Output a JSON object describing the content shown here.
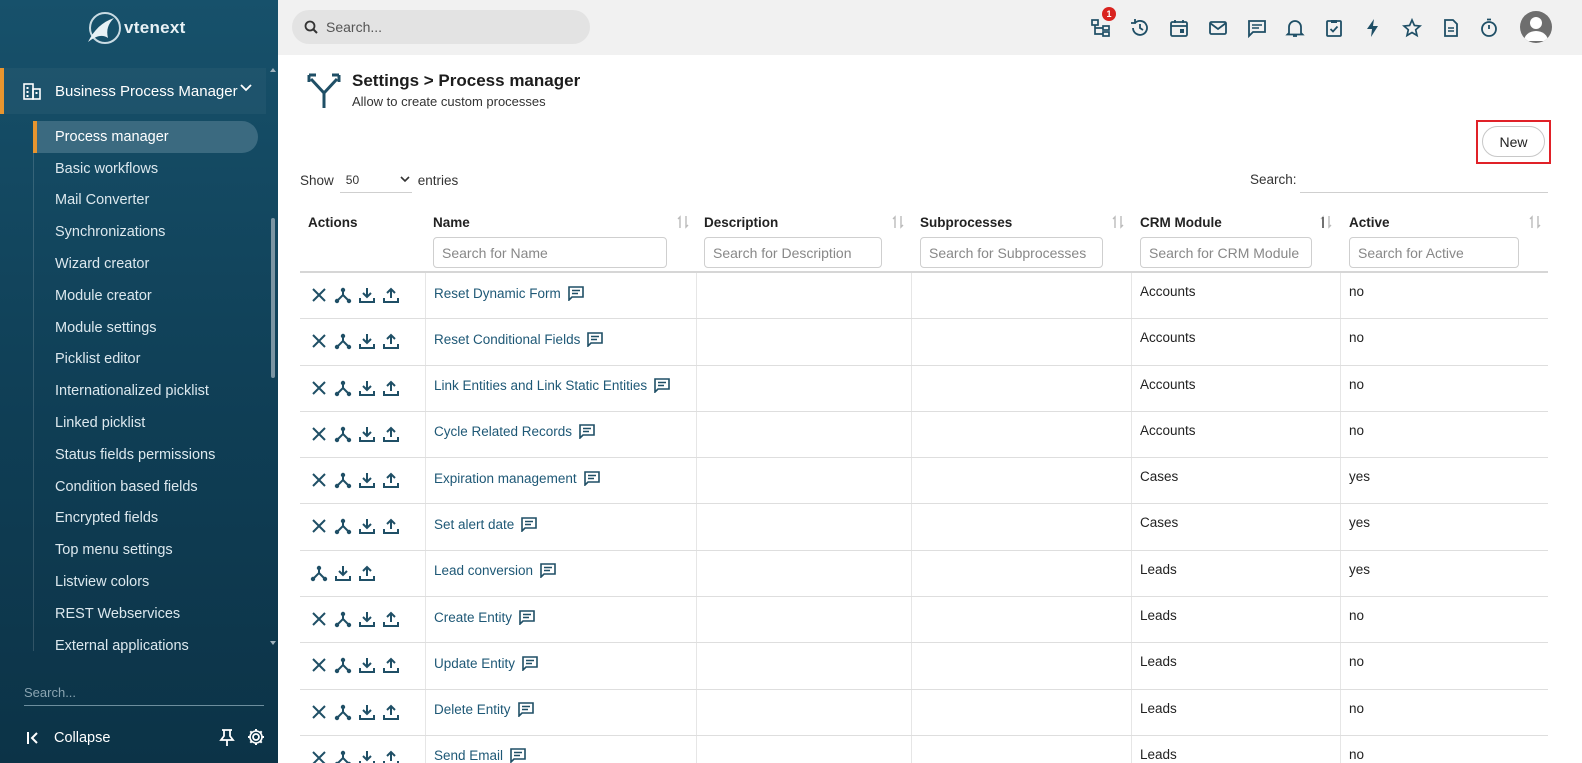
{
  "brand": {
    "logo_text": "vtenext"
  },
  "sidebar": {
    "section_label": "Business Process Manager",
    "items": [
      {
        "label": "Process manager",
        "active": true
      },
      {
        "label": "Basic workflows"
      },
      {
        "label": "Mail Converter"
      },
      {
        "label": "Synchronizations"
      },
      {
        "label": "Wizard creator"
      },
      {
        "label": "Module creator"
      },
      {
        "label": "Module settings"
      },
      {
        "label": "Picklist editor"
      },
      {
        "label": "Internationalized picklist"
      },
      {
        "label": "Linked picklist"
      },
      {
        "label": "Status fields permissions"
      },
      {
        "label": "Condition based fields"
      },
      {
        "label": "Encrypted fields"
      },
      {
        "label": "Top menu settings"
      },
      {
        "label": "Listview colors"
      },
      {
        "label": "REST Webservices"
      },
      {
        "label": "External applications"
      }
    ],
    "search_placeholder": "Search...",
    "collapse_label": "Collapse"
  },
  "topbar": {
    "search_placeholder": "Search...",
    "icons": [
      "process-tree-icon",
      "history-icon",
      "calendar-icon",
      "mail-icon",
      "chat-icon",
      "bell-icon",
      "task-check-icon",
      "lightning-icon",
      "star-icon",
      "document-icon",
      "timer-icon"
    ],
    "notification_badge": "1"
  },
  "page": {
    "title": "Settings > Process manager",
    "subtitle": "Allow to create custom processes",
    "new_button": "New"
  },
  "table_controls": {
    "show_label": "Show",
    "entries_value": "50",
    "entries_label": "entries",
    "search_label": "Search:"
  },
  "table": {
    "columns": [
      {
        "label": "Actions"
      },
      {
        "label": "Name",
        "filter_placeholder": "Search for Name"
      },
      {
        "label": "Description",
        "filter_placeholder": "Search for Description"
      },
      {
        "label": "Subprocesses",
        "filter_placeholder": "Search for Subprocesses"
      },
      {
        "label": "CRM Module",
        "filter_placeholder": "Search for CRM Module"
      },
      {
        "label": "Active",
        "filter_placeholder": "Search for Active"
      }
    ],
    "rows": [
      {
        "name": "Reset Dynamic Form",
        "description": "",
        "subprocesses": "",
        "module": "Accounts",
        "active": "no",
        "deletable": true
      },
      {
        "name": "Reset Conditional Fields",
        "description": "",
        "subprocesses": "",
        "module": "Accounts",
        "active": "no",
        "deletable": true
      },
      {
        "name": "Link Entities and Link Static Entities",
        "description": "",
        "subprocesses": "",
        "module": "Accounts",
        "active": "no",
        "deletable": true
      },
      {
        "name": "Cycle Related Records",
        "description": "",
        "subprocesses": "",
        "module": "Accounts",
        "active": "no",
        "deletable": true
      },
      {
        "name": "Expiration management",
        "description": "",
        "subprocesses": "",
        "module": "Cases",
        "active": "yes",
        "deletable": true
      },
      {
        "name": "Set alert date",
        "description": "",
        "subprocesses": "",
        "module": "Cases",
        "active": "yes",
        "deletable": true
      },
      {
        "name": "Lead conversion",
        "description": "",
        "subprocesses": "",
        "module": "Leads",
        "active": "yes",
        "deletable": false
      },
      {
        "name": "Create Entity",
        "description": "",
        "subprocesses": "",
        "module": "Leads",
        "active": "no",
        "deletable": true
      },
      {
        "name": "Update Entity",
        "description": "",
        "subprocesses": "",
        "module": "Leads",
        "active": "no",
        "deletable": true
      },
      {
        "name": "Delete Entity",
        "description": "",
        "subprocesses": "",
        "module": "Leads",
        "active": "no",
        "deletable": true
      },
      {
        "name": "Send Email",
        "description": "",
        "subprocesses": "",
        "module": "Leads",
        "active": "no",
        "deletable": true
      }
    ]
  },
  "colors": {
    "accent": "#e8952f",
    "link": "#1e5876",
    "sidebar": "#17516b",
    "highlight": "#e02128"
  }
}
